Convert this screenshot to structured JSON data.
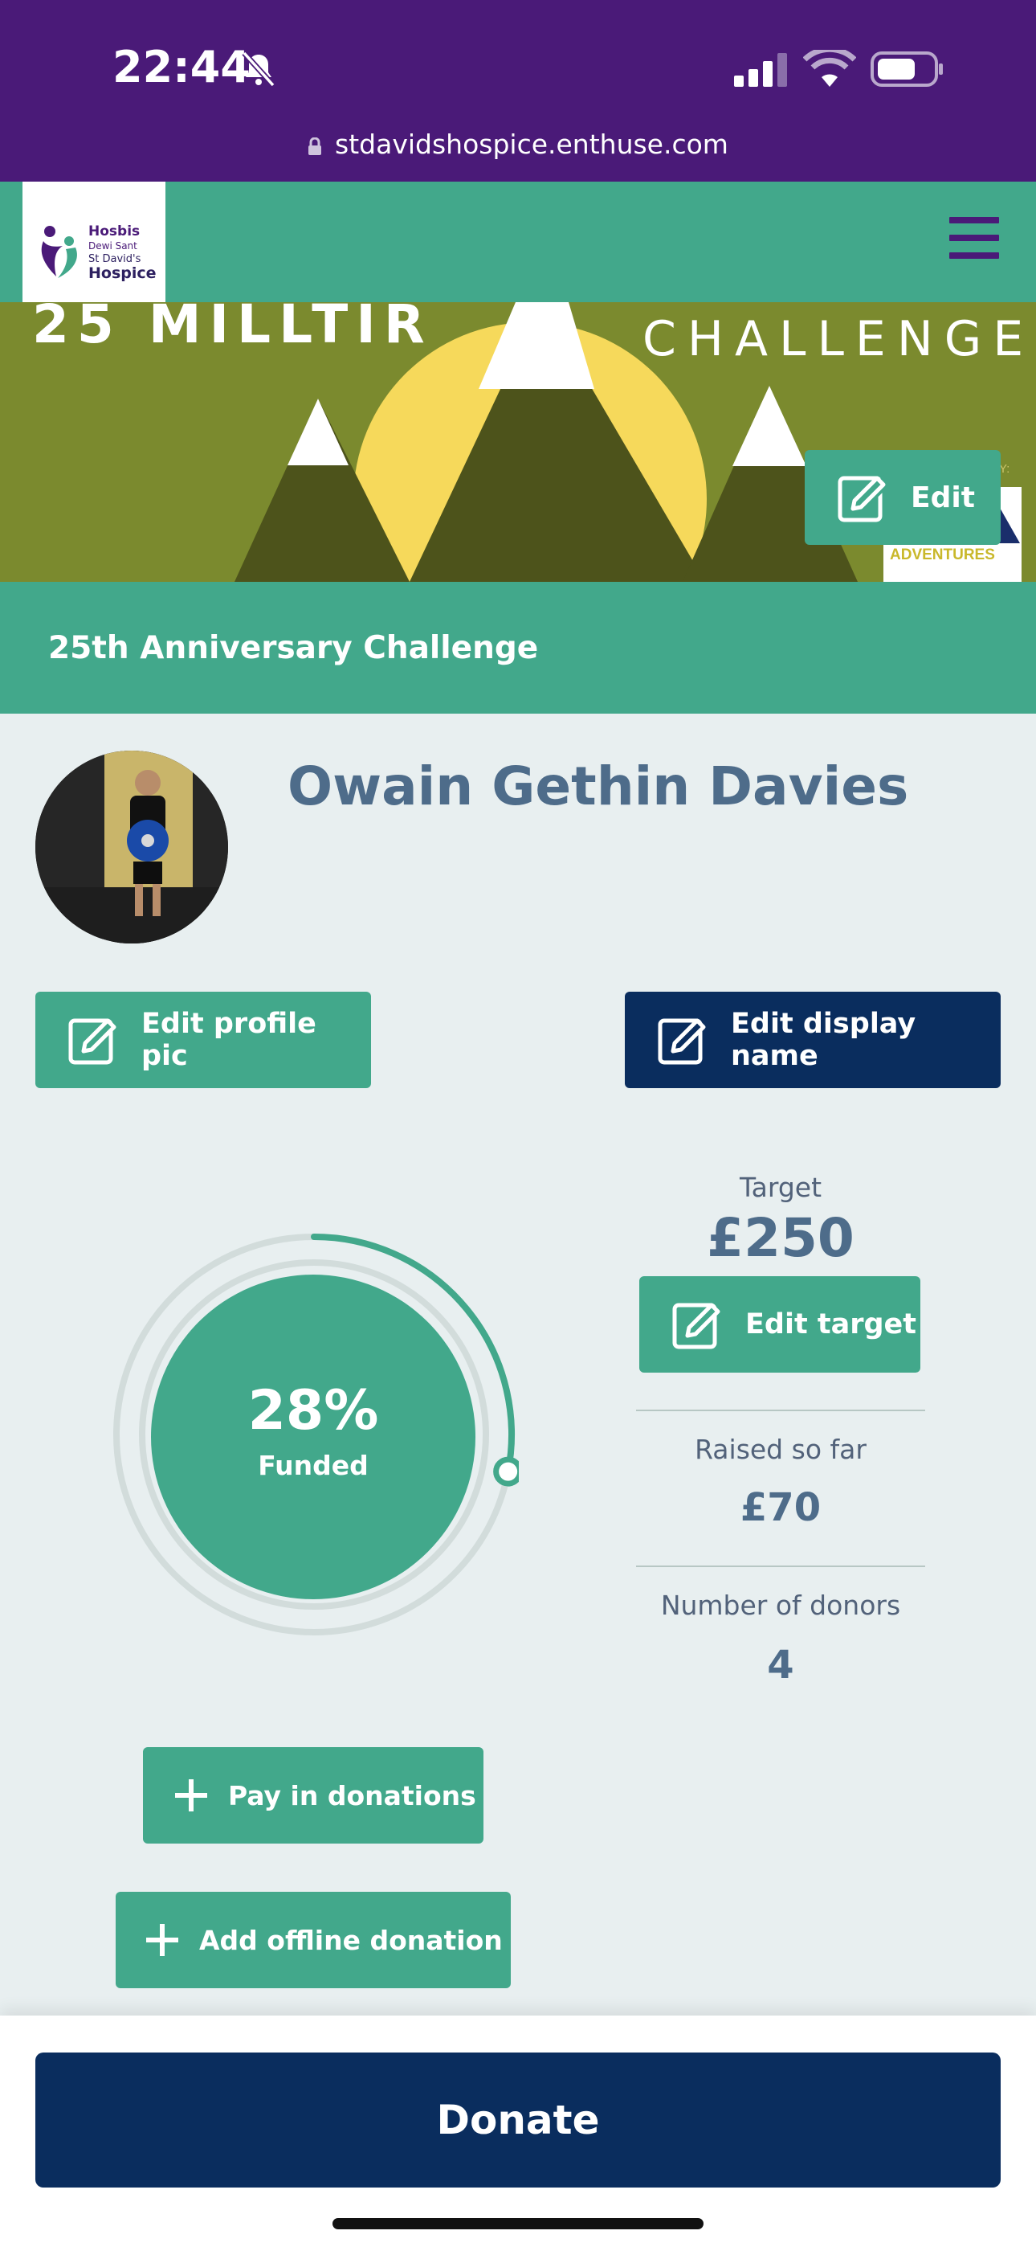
{
  "status_bar": {
    "time": "22:44",
    "url": "stdavidshospice.enthuse.com"
  },
  "logo": {
    "line1": "Hosbis",
    "line2": "Dewi Sant",
    "line3": "St David's",
    "line4": "Hospice"
  },
  "banner": {
    "left_text": "25 MILLTIR",
    "right_text": "CHALLENGE",
    "partner_small": "BY:",
    "partner_text": "ADVENTURES",
    "edit_label": "Edit"
  },
  "challenge_title": "25th Anniversary Challenge",
  "profile": {
    "name": "Owain Gethin Davies",
    "edit_pic_label": "Edit profile pic",
    "edit_name_label": "Edit display name"
  },
  "progress": {
    "percent_text": "28%",
    "funded_label": "Funded",
    "fraction": 0.28
  },
  "stats": {
    "target_label": "Target",
    "target_value": "£250",
    "edit_target_label": "Edit target",
    "raised_label": "Raised so far",
    "raised_value": "£70",
    "donors_label": "Number of donors",
    "donors_value": "4"
  },
  "actions": {
    "pay_in_label": "Pay in donations",
    "offline_label": "Add offline donation",
    "donate_label": "Donate"
  },
  "colors": {
    "status_bar": "#4a1a78",
    "teal": "#42a88b",
    "navy": "#0a2d5e",
    "name_text": "#4e6c8a",
    "banner_olive": "#7b8a2e"
  }
}
